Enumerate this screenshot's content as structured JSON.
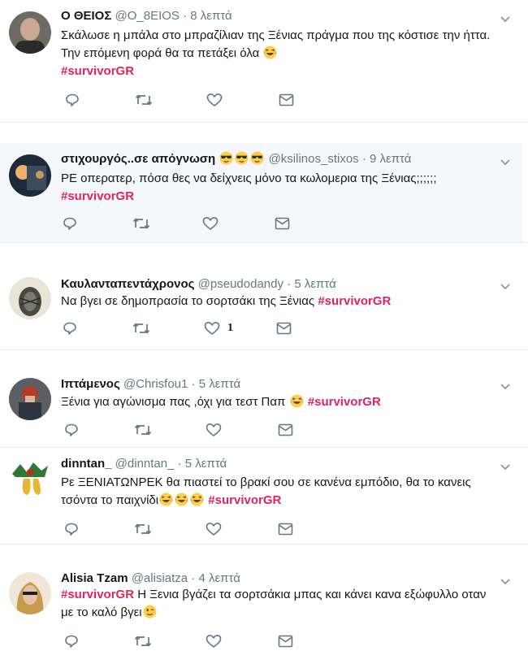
{
  "tweets": [
    {
      "name": "Ο ΘΕΙΟΣ",
      "handle": "@O_8EIOS",
      "time": "8 λεπτά",
      "lines": [
        "Σκάλωσε η μπάλα στο μπραζίλιαν της Ξένιας πράγμα που της κόστισε την ήττα.",
        "Την επόμενη φορά θα τα πετάξει όλα"
      ],
      "hashtag": "#survivorGR",
      "likes": ""
    },
    {
      "name": "στιχουργός..σε απόγνωση",
      "handle": "@ksilinos_stixos",
      "time": "9 λεπτά",
      "lines": [
        "ΡΕ οπερατερ, πόσα θες να δείχνεις μόνο τα κωλομερια της Ξένιας;;;;;;"
      ],
      "hashtag": "#survivorGR",
      "likes": ""
    },
    {
      "name": "Καυλανταπεντάχρονος",
      "handle": "@pseudodandy",
      "time": "5 λεπτά",
      "lines": [
        "Να βγει σε δημοπρασία το σορτσάκι της Ξένιας"
      ],
      "hashtag": "#survivorGR",
      "likes": "1"
    },
    {
      "name": "Ιπτάμενος",
      "handle": "@Chrisfou1",
      "time": "5 λεπτά",
      "lines": [
        "Ξένια για αγώνισμα πας ,όχι για τεστ Παπ"
      ],
      "hashtag": "#survivorGR",
      "likes": ""
    },
    {
      "name": "dinntan_",
      "handle": "@dinntan_",
      "time": "5 λεπτά",
      "lines": [
        "Ρε ΞΕΝΙΑΤΩΝΡΕΚ θα πιαστεί το βρακί σου σε κανένα εμπόδιο, θα το κανεις",
        "τσόντα το παιχνίδι"
      ],
      "hashtag": "#survivorGR",
      "likes": ""
    },
    {
      "name": "Alisia Tzam",
      "handle": "@alisiatza",
      "time": "4 λεπτά",
      "lines": [
        "Η Ξενια βγάζει τα σορτσάκια μπας και κάνει κανα εξώφυλλο οταν",
        "με το καλό βγει"
      ],
      "hashtag": "#survivorGR",
      "likes": ""
    }
  ],
  "separator": "·",
  "icons": [
    "reply-icon",
    "retweet-icon",
    "like-icon",
    "direct-message-icon",
    "chevron-down-icon",
    "laughing-emoji",
    "sunglasses-emoji",
    "wink-emoji"
  ],
  "colors": {
    "hashtag": "#e0245e",
    "muted": "#657786",
    "highlight": "#f5f8fa",
    "divider": "#e6ecf0",
    "emoji": "#ffcc4d"
  }
}
